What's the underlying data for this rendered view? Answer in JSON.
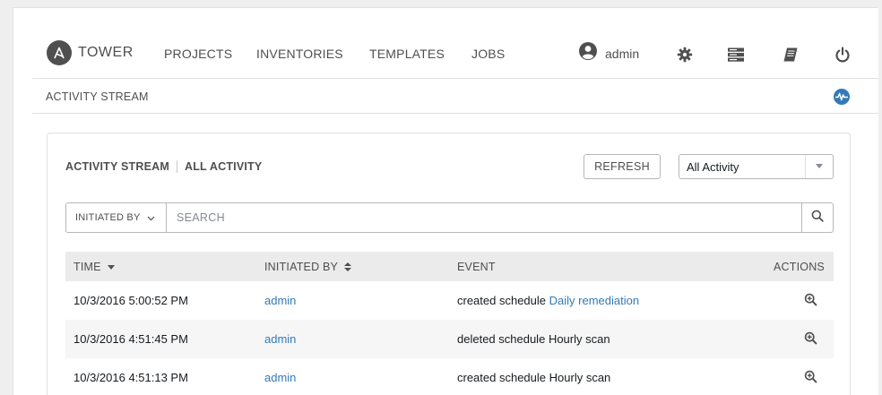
{
  "nav": {
    "logo_text": "TOWER",
    "links": [
      "PROJECTS",
      "INVENTORIES",
      "TEMPLATES",
      "JOBS"
    ],
    "user": "admin",
    "icons": [
      "user-icon",
      "gear-icon",
      "server-icon",
      "book-icon",
      "power-icon"
    ]
  },
  "subbar": {
    "title": "ACTIVITY STREAM",
    "icon": "activity-stream-icon"
  },
  "panel": {
    "title_left": "ACTIVITY STREAM",
    "title_right": "ALL ACTIVITY",
    "refresh_label": "REFRESH",
    "filter_value": "All Activity"
  },
  "search": {
    "field_label": "INITIATED BY",
    "placeholder": "SEARCH"
  },
  "table": {
    "headers": {
      "time": "TIME",
      "initiated_by": "INITIATED BY",
      "event": "EVENT",
      "actions": "ACTIONS"
    },
    "rows": [
      {
        "time": "10/3/2016 5:00:52 PM",
        "user": "admin",
        "event_prefix": "created schedule",
        "event_object": "Daily remediation",
        "object_linked": true
      },
      {
        "time": "10/3/2016 4:51:45 PM",
        "user": "admin",
        "event_prefix": "deleted schedule",
        "event_object": "Hourly scan",
        "object_linked": false
      },
      {
        "time": "10/3/2016 4:51:13 PM",
        "user": "admin",
        "event_prefix": "created schedule",
        "event_object": "Hourly scan",
        "object_linked": false
      }
    ]
  },
  "colors": {
    "link": "#337ab7",
    "text": "#161b1f",
    "muted": "#4f4f4f",
    "header_bg": "#ebebeb",
    "alt_row_bg": "#f6f6f6"
  }
}
